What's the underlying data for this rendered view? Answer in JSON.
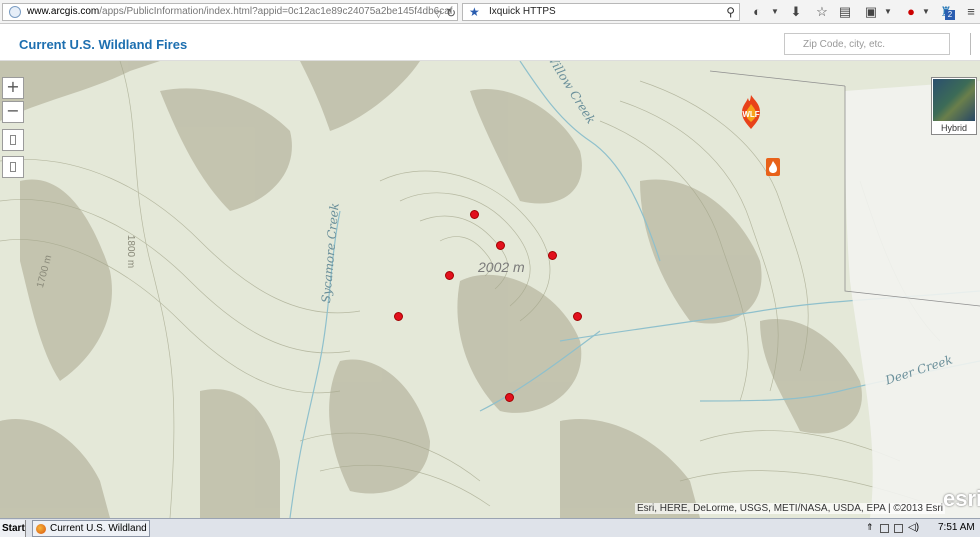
{
  "browser": {
    "url_domain": "www.arcgis.com",
    "url_path": "/apps/PublicInformation/index.html?appid=0c12ac1e89c24075a2be145f4db6caf",
    "search_engine": "Ixquick HTTPS",
    "addon_badge": "2"
  },
  "app": {
    "title": "Current U.S. Wildland Fires",
    "search_placeholder": "Zip Code, city, etc."
  },
  "map": {
    "zoom_in_label": "+",
    "zoom_out_label": "−",
    "basemap_toggle_label": "Hybrid",
    "elevation_label": "2002 m",
    "contour_labels": [
      "1700 m",
      "1800 m"
    ],
    "water_labels": [
      "Sycamore Creek",
      "Deer Creek",
      "Willow Creek"
    ],
    "wlf_badge": "WLF",
    "attribution": "Esri, HERE, DeLorme, USGS, METI/NASA, USDA, EPA | ©2013 Esri",
    "logo_text": "esri",
    "fire_dot_color": "#e2101d"
  },
  "taskbar": {
    "start_label": "Start",
    "window_title": "Current U.S. Wildland F...",
    "clock": "7:51 AM"
  }
}
